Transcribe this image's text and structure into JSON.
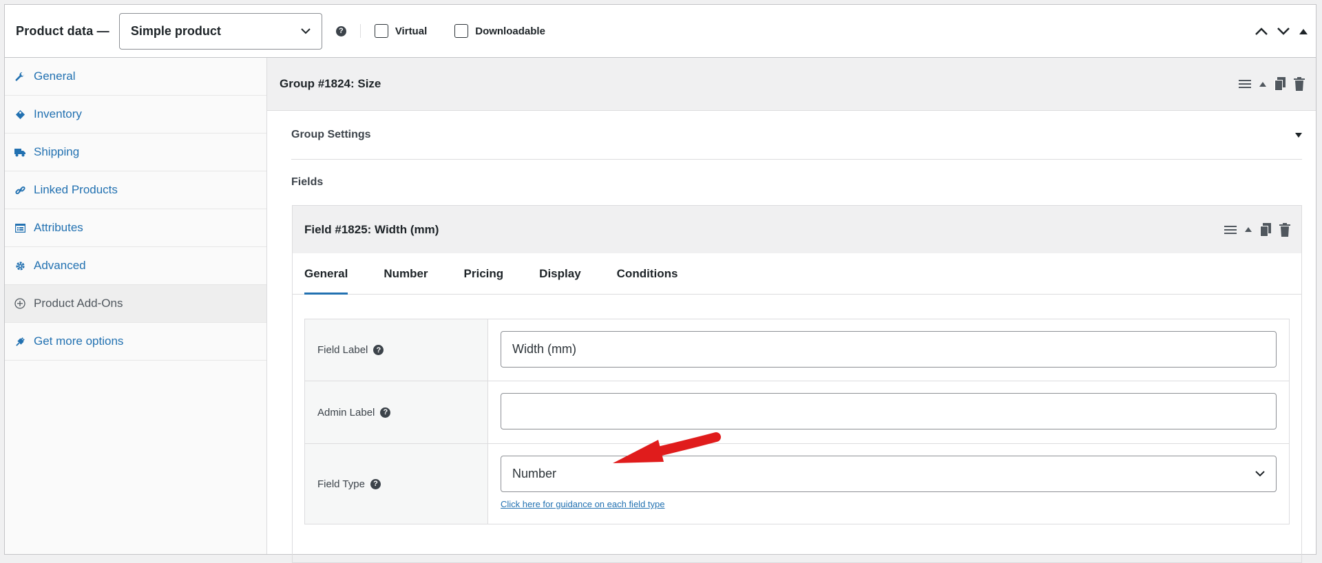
{
  "header": {
    "title": "Product data —",
    "product_type": "Simple product",
    "help": "?",
    "virtual_label": "Virtual",
    "downloadable_label": "Downloadable"
  },
  "sidebar": {
    "items": [
      {
        "label": "General",
        "icon": "wrench-icon"
      },
      {
        "label": "Inventory",
        "icon": "tag-icon"
      },
      {
        "label": "Shipping",
        "icon": "truck-icon"
      },
      {
        "label": "Linked Products",
        "icon": "link-icon"
      },
      {
        "label": "Attributes",
        "icon": "list-icon"
      },
      {
        "label": "Advanced",
        "icon": "gear-icon"
      },
      {
        "label": "Product Add-Ons",
        "icon": "plus-circle-icon"
      },
      {
        "label": "Get more options",
        "icon": "plugin-icon"
      }
    ]
  },
  "group": {
    "title": "Group #1824: Size",
    "settings_label": "Group Settings",
    "fields_label": "Fields"
  },
  "field": {
    "title": "Field #1825: Width (mm)",
    "tabs": [
      "General",
      "Number",
      "Pricing",
      "Display",
      "Conditions"
    ],
    "rows": {
      "label": {
        "name": "Field Label",
        "value": "Width (mm)"
      },
      "admin": {
        "name": "Admin Label",
        "value": ""
      },
      "type": {
        "name": "Field Type",
        "value": "Number",
        "guidance": "Click here for guidance on each field type"
      }
    }
  },
  "colors": {
    "accent": "#2271b1",
    "arrow": "#e01c1c"
  }
}
